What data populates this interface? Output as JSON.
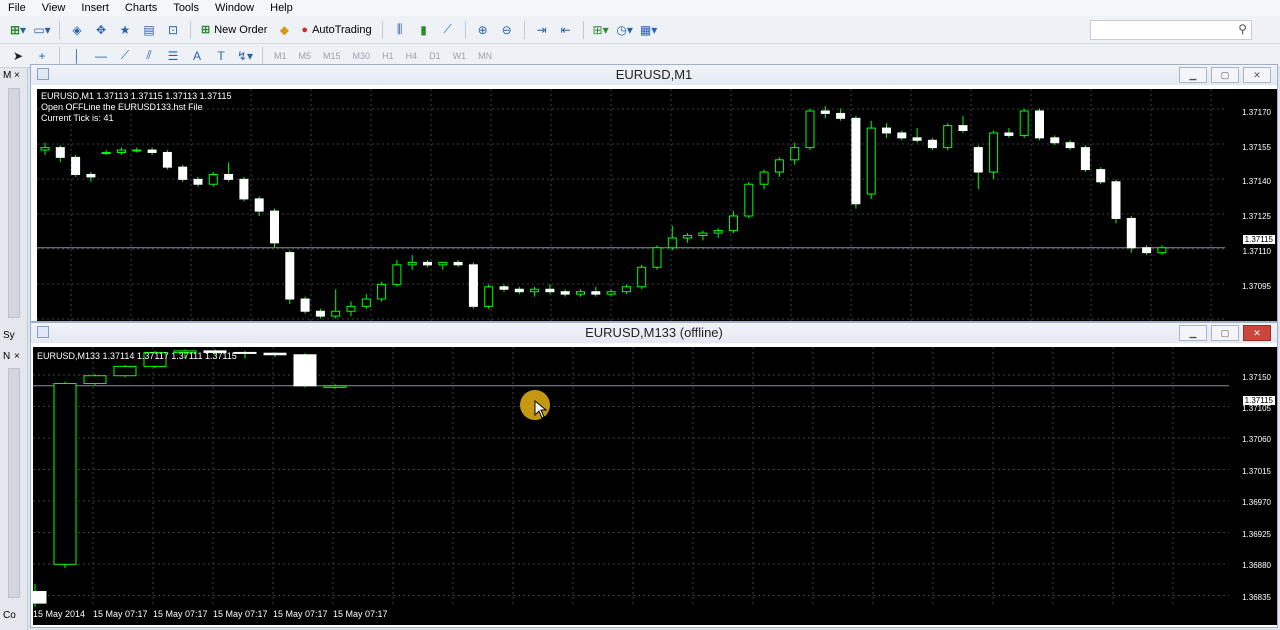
{
  "menu": [
    "File",
    "View",
    "Insert",
    "Charts",
    "Tools",
    "Window",
    "Help"
  ],
  "toolbar": {
    "new_order": "New Order",
    "autotrading": "AutoTrading"
  },
  "timeframes": [
    "M1",
    "M5",
    "M15",
    "M30",
    "H1",
    "H4",
    "D1",
    "W1",
    "MN"
  ],
  "left_strip": {
    "tab1": "Sy",
    "tab2": "N",
    "tab3": "Co"
  },
  "colors": {
    "bull": "#00ff00",
    "bear": "#ffffff",
    "grid": "#3a3f4a",
    "bg": "#000000"
  },
  "window1": {
    "title": "EURUSD,M1",
    "info_line1": "EURUSD,M1  1.37113 1.37115 1.37113 1.37115",
    "info_line2": "Open OFFLine the EURUSD133.hst File",
    "info_line3": "Current Tick is: 41",
    "current_price": "1.37115",
    "price_labels": [
      "1.37170",
      "1.37155",
      "1.37140",
      "1.37125",
      "1.37110",
      "1.37095"
    ]
  },
  "window2": {
    "title": "EURUSD,M133 (offline)",
    "info_line1": "EURUSD,M133  1.37114 1.37117 1.37111 1.37115",
    "current_price": "1.37115",
    "price_labels": [
      "1.37150",
      "1.37105",
      "1.37060",
      "1.37015",
      "1.36970",
      "1.36925",
      "1.36880",
      "1.36835"
    ],
    "x_labels": [
      "15 May 2014",
      "15 May 07:17",
      "15 May 07:17",
      "15 May 07:17",
      "15 May 07:17",
      "15 May 07:17"
    ]
  },
  "chart_data": [
    {
      "type": "candlestick",
      "title": "EURUSD,M1",
      "ylim": [
        1.37085,
        1.3718
      ],
      "ohlc": [
        [
          1.37155,
          1.37158,
          1.37153,
          1.37156
        ],
        [
          1.37156,
          1.37157,
          1.3715,
          1.37152
        ],
        [
          1.37152,
          1.37153,
          1.37144,
          1.37145
        ],
        [
          1.37145,
          1.37146,
          1.37142,
          1.37144
        ],
        [
          1.37154,
          1.37155,
          1.37153,
          1.37154
        ],
        [
          1.37154,
          1.37156,
          1.37153,
          1.37155
        ],
        [
          1.37155,
          1.37156,
          1.37154,
          1.37155
        ],
        [
          1.37155,
          1.37156,
          1.37153,
          1.37154
        ],
        [
          1.37154,
          1.37155,
          1.37147,
          1.37148
        ],
        [
          1.37148,
          1.37149,
          1.37142,
          1.37143
        ],
        [
          1.37143,
          1.37144,
          1.3714,
          1.37141
        ],
        [
          1.37141,
          1.37146,
          1.3714,
          1.37145
        ],
        [
          1.37145,
          1.3715,
          1.37142,
          1.37143
        ],
        [
          1.37143,
          1.37144,
          1.37134,
          1.37135
        ],
        [
          1.37135,
          1.37136,
          1.37128,
          1.3713
        ],
        [
          1.3713,
          1.37131,
          1.37115,
          1.37117
        ],
        [
          1.37113,
          1.37114,
          1.37092,
          1.37094
        ],
        [
          1.37094,
          1.37095,
          1.37088,
          1.37089
        ],
        [
          1.37089,
          1.3709,
          1.37086,
          1.37087
        ],
        [
          1.37087,
          1.37098,
          1.37086,
          1.37089
        ],
        [
          1.37089,
          1.37093,
          1.37087,
          1.37091
        ],
        [
          1.37091,
          1.37096,
          1.3709,
          1.37094
        ],
        [
          1.37094,
          1.37101,
          1.37093,
          1.371
        ],
        [
          1.371,
          1.3711,
          1.37099,
          1.37108
        ],
        [
          1.37108,
          1.37112,
          1.37106,
          1.37109
        ],
        [
          1.37109,
          1.3711,
          1.37107,
          1.37108
        ],
        [
          1.37108,
          1.37109,
          1.37106,
          1.37109
        ],
        [
          1.37109,
          1.3711,
          1.37107,
          1.37108
        ],
        [
          1.37108,
          1.37109,
          1.3709,
          1.37091
        ],
        [
          1.37091,
          1.371,
          1.3709,
          1.37099
        ],
        [
          1.37099,
          1.371,
          1.37097,
          1.37098
        ],
        [
          1.37098,
          1.37099,
          1.37096,
          1.37097
        ],
        [
          1.37097,
          1.37099,
          1.37095,
          1.37098
        ],
        [
          1.37098,
          1.371,
          1.37096,
          1.37097
        ],
        [
          1.37097,
          1.37098,
          1.37095,
          1.37096
        ],
        [
          1.37096,
          1.37098,
          1.37095,
          1.37097
        ],
        [
          1.37097,
          1.37099,
          1.37095,
          1.37096
        ],
        [
          1.37096,
          1.37098,
          1.37095,
          1.37097
        ],
        [
          1.37097,
          1.371,
          1.37096,
          1.37099
        ],
        [
          1.37099,
          1.37108,
          1.37098,
          1.37107
        ],
        [
          1.37107,
          1.37116,
          1.37106,
          1.37115
        ],
        [
          1.37115,
          1.37124,
          1.37114,
          1.37119
        ],
        [
          1.37119,
          1.37121,
          1.37117,
          1.3712
        ],
        [
          1.3712,
          1.37122,
          1.37118,
          1.37121
        ],
        [
          1.37121,
          1.37123,
          1.37119,
          1.37122
        ],
        [
          1.37122,
          1.3713,
          1.37121,
          1.37128
        ],
        [
          1.37128,
          1.37142,
          1.37127,
          1.37141
        ],
        [
          1.37141,
          1.37147,
          1.37139,
          1.37146
        ],
        [
          1.37146,
          1.37152,
          1.37144,
          1.37151
        ],
        [
          1.37151,
          1.37158,
          1.37149,
          1.37156
        ],
        [
          1.37156,
          1.37172,
          1.37155,
          1.37171
        ],
        [
          1.37171,
          1.37173,
          1.37168,
          1.3717
        ],
        [
          1.3717,
          1.37172,
          1.37167,
          1.37168
        ],
        [
          1.37168,
          1.37169,
          1.37131,
          1.37133
        ],
        [
          1.37137,
          1.37167,
          1.37135,
          1.37164
        ],
        [
          1.37164,
          1.37166,
          1.3716,
          1.37162
        ],
        [
          1.37162,
          1.37163,
          1.37159,
          1.3716
        ],
        [
          1.3716,
          1.37164,
          1.37158,
          1.37159
        ],
        [
          1.37159,
          1.3716,
          1.37155,
          1.37156
        ],
        [
          1.37156,
          1.37166,
          1.37155,
          1.37165
        ],
        [
          1.37165,
          1.37169,
          1.37162,
          1.37163
        ],
        [
          1.37156,
          1.37157,
          1.37139,
          1.37146
        ],
        [
          1.37146,
          1.37163,
          1.37143,
          1.37162
        ],
        [
          1.37162,
          1.37164,
          1.3716,
          1.37161
        ],
        [
          1.37161,
          1.37172,
          1.3716,
          1.37171
        ],
        [
          1.37171,
          1.37172,
          1.37159,
          1.3716
        ],
        [
          1.3716,
          1.37161,
          1.37157,
          1.37158
        ],
        [
          1.37158,
          1.37159,
          1.37155,
          1.37156
        ],
        [
          1.37156,
          1.37157,
          1.37146,
          1.37147
        ],
        [
          1.37147,
          1.37148,
          1.37141,
          1.37142
        ],
        [
          1.37142,
          1.37143,
          1.37125,
          1.37127
        ],
        [
          1.37127,
          1.37128,
          1.37113,
          1.37115
        ],
        [
          1.37115,
          1.37116,
          1.37112,
          1.37113
        ],
        [
          1.37113,
          1.37116,
          1.37112,
          1.37115
        ]
      ]
    },
    {
      "type": "candlestick",
      "title": "EURUSD,M133 (offline)",
      "ylim": [
        1.3683,
        1.37165
      ],
      "ohlc": [
        [
          1.3685,
          1.3686,
          1.3683,
          1.36835
        ],
        [
          1.36885,
          1.3712,
          1.3688,
          1.37118
        ],
        [
          1.37118,
          1.3713,
          1.37116,
          1.37128
        ],
        [
          1.37128,
          1.37142,
          1.37126,
          1.3714
        ],
        [
          1.3714,
          1.3716,
          1.37138,
          1.37158
        ],
        [
          1.37158,
          1.37162,
          1.3715,
          1.3716
        ],
        [
          1.3716,
          1.37162,
          1.37155,
          1.37158
        ],
        [
          1.37158,
          1.3716,
          1.3715,
          1.37157
        ],
        [
          1.37157,
          1.37158,
          1.37152,
          1.37155
        ],
        [
          1.37155,
          1.37157,
          1.37113,
          1.37115
        ],
        [
          1.37113,
          1.37117,
          1.37111,
          1.37115
        ]
      ]
    }
  ]
}
